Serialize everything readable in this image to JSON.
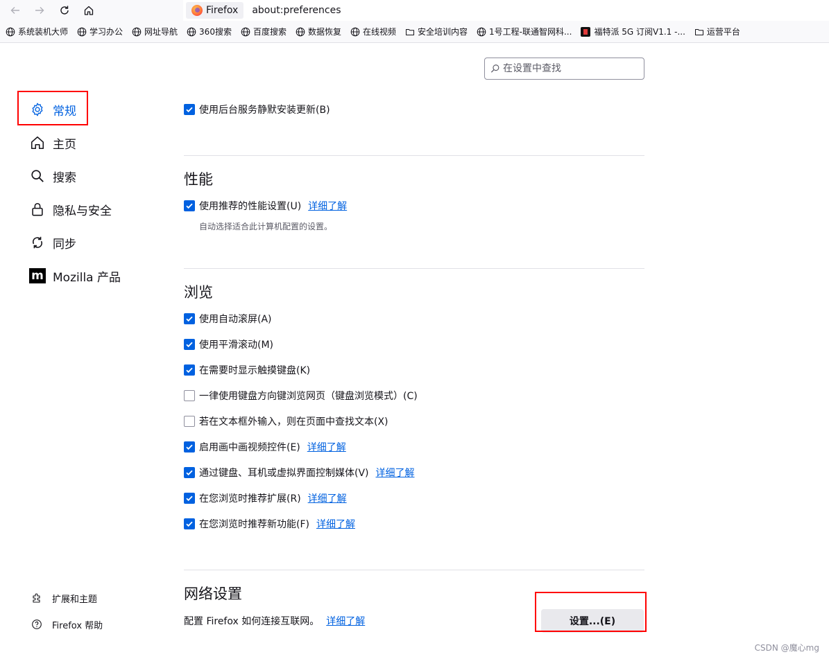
{
  "browser": {
    "identity_label": "Firefox",
    "url": "about:preferences"
  },
  "bookmarks": [
    {
      "label": "系统装机大师",
      "icon": "globe-icon"
    },
    {
      "label": "学习办公",
      "icon": "globe-icon"
    },
    {
      "label": "网址导航",
      "icon": "globe-icon"
    },
    {
      "label": "360搜索",
      "icon": "globe-icon"
    },
    {
      "label": "百度搜索",
      "icon": "globe-icon"
    },
    {
      "label": "数据恢复",
      "icon": "globe-icon"
    },
    {
      "label": "在线视频",
      "icon": "globe-icon"
    },
    {
      "label": "安全培训内容",
      "icon": "folder-icon"
    },
    {
      "label": "1号工程-联通智网科...",
      "icon": "globe-icon"
    },
    {
      "label": "福特派 5G 订阅V1.1 -...",
      "icon": "app-icon"
    },
    {
      "label": "运营平台",
      "icon": "folder-icon"
    }
  ],
  "search": {
    "placeholder": "在设置中查找"
  },
  "sidebar": {
    "items": [
      {
        "label": "常规",
        "icon": "gear-icon",
        "active": true
      },
      {
        "label": "主页",
        "icon": "home-icon",
        "active": false
      },
      {
        "label": "搜索",
        "icon": "search-icon",
        "active": false
      },
      {
        "label": "隐私与安全",
        "icon": "lock-icon",
        "active": false
      },
      {
        "label": "同步",
        "icon": "sync-icon",
        "active": false
      },
      {
        "label": "Mozilla 产品",
        "icon": "mozilla-logo-icon",
        "active": false
      }
    ],
    "footer": [
      {
        "label": "扩展和主题",
        "icon": "puzzle-icon"
      },
      {
        "label": "Firefox 帮助",
        "icon": "help-icon"
      }
    ]
  },
  "updates": {
    "background_service": {
      "label": "使用后台服务静默安装更新(B)",
      "checked": true
    }
  },
  "performance": {
    "heading": "性能",
    "recommended": {
      "label": "使用推荐的性能设置(U)",
      "checked": true,
      "learn_more": "详细了解"
    },
    "description": "自动选择适合此计算机配置的设置。"
  },
  "browsing": {
    "heading": "浏览",
    "options": [
      {
        "label": "使用自动滚屏(A)",
        "checked": true,
        "learn_more": ""
      },
      {
        "label": "使用平滑滚动(M)",
        "checked": true,
        "learn_more": ""
      },
      {
        "label": "在需要时显示触摸键盘(K)",
        "checked": true,
        "learn_more": ""
      },
      {
        "label": "一律使用键盘方向键浏览网页（键盘浏览模式）(C)",
        "checked": false,
        "learn_more": ""
      },
      {
        "label": "若在文本框外输入，则在页面中查找文本(X)",
        "checked": false,
        "learn_more": ""
      },
      {
        "label": "启用画中画视频控件(E)",
        "checked": true,
        "learn_more": "详细了解"
      },
      {
        "label": "通过键盘、耳机或虚拟界面控制媒体(V)",
        "checked": true,
        "learn_more": "详细了解"
      },
      {
        "label": "在您浏览时推荐扩展(R)",
        "checked": true,
        "learn_more": "详细了解"
      },
      {
        "label": "在您浏览时推荐新功能(F)",
        "checked": true,
        "learn_more": "详细了解"
      }
    ]
  },
  "network": {
    "heading": "网络设置",
    "description": "配置 Firefox 如何连接互联网。",
    "learn_more": "详细了解",
    "settings_button": "设置...(E)"
  },
  "watermark": "CSDN @魔心mg",
  "colors": {
    "accent": "#0061e0",
    "highlight": "#ff0000"
  }
}
